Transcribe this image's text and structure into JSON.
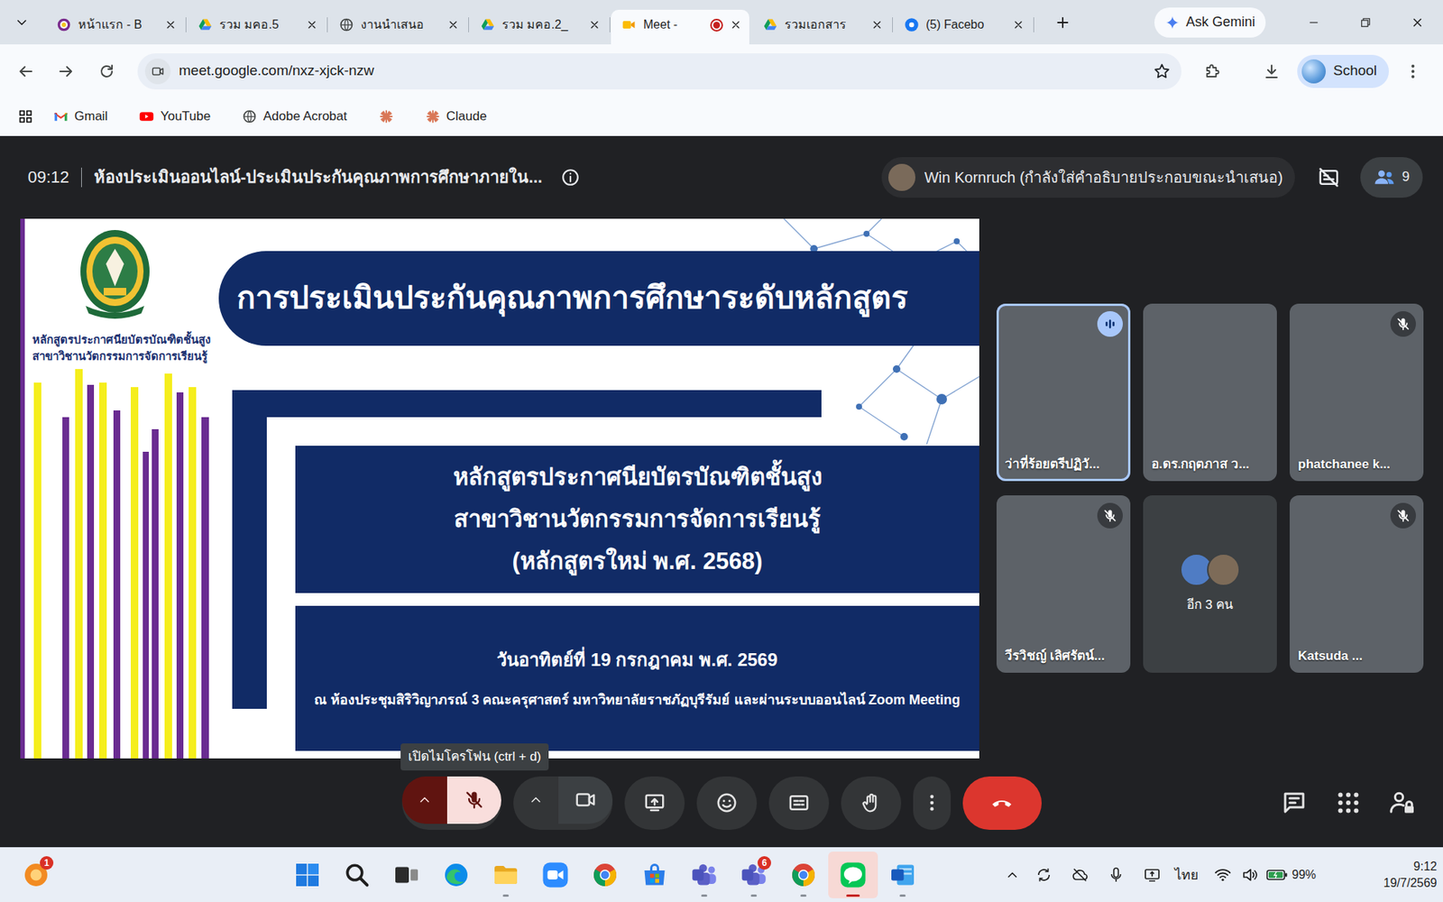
{
  "browser": {
    "tabs": [
      {
        "label": "หน้าแรก - B",
        "kind": "school",
        "selected": false,
        "recording": false
      },
      {
        "label": "รวม มคอ.5",
        "kind": "drive",
        "selected": false,
        "recording": false
      },
      {
        "label": "งานนำเสนอ",
        "kind": "globe",
        "selected": false,
        "recording": false
      },
      {
        "label": "รวม มคอ.2_",
        "kind": "drive",
        "selected": false,
        "recording": false
      },
      {
        "label": "Meet -",
        "kind": "meet",
        "selected": true,
        "recording": true
      },
      {
        "label": "รวมเอกสาร",
        "kind": "drive",
        "selected": false,
        "recording": false
      },
      {
        "label": "(5) Facebo",
        "kind": "facebook",
        "selected": false,
        "recording": false
      }
    ],
    "gemini": "Ask Gemini",
    "address": "meet.google.com/nxz-xjck-nzw",
    "profile": "School",
    "bookmarks": [
      {
        "kind": "gmail",
        "label": "Gmail"
      },
      {
        "kind": "youtube",
        "label": "YouTube"
      },
      {
        "kind": "acrobat",
        "label": "Adobe Acrobat"
      },
      {
        "kind": "claude"
      },
      {
        "kind": "claude",
        "label": "Claude"
      }
    ]
  },
  "meet": {
    "time": "09:12",
    "title": "ห้องประเมินออนไลน์-ประเมินประกันคุณภาพการศึกษาภายใน...",
    "presenter": "Win Kornruch (กำลังใส่คำอธิบายประกอบขณะนำเสนอ)",
    "participant_count": "9",
    "slide": {
      "side_title": [
        "หลักสูตรประกาศนียบัตรบัณฑิตชั้นสูง",
        "สาขาวิชานวัตกรรมการจัดการเรียนรู้"
      ],
      "heading": "การประเมินประกันคุณภาพการศึกษาระดับหลักสูตร",
      "program": [
        "หลักสูตรประกาศนียบัตรบัณฑิตชั้นสูง",
        "สาขาวิชานวัตกรรมการจัดการเรียนรู้",
        "(หลักสูตรใหม่ พ.ศ. 2568)"
      ],
      "date": "วันอาทิตย์ที่ 19 กรกฎาคม พ.ศ. 2569",
      "venue": "ณ ห้องประชุมสิริวิญาภรณ์ 3 คณะครุศาสตร์ มหาวิทยาลัยราชภัฏบุรีรัมย์ และผ่านระบบออนไลน์ Zoom Meeting"
    },
    "tiles": [
      {
        "kind": "video",
        "name": "ว่าที่ร้อยตรีปฏิวั...",
        "muted": false,
        "speaking": true
      },
      {
        "kind": "video",
        "name": "อ.ดร.กฤตภาส ว...",
        "muted": false,
        "speaking": false
      },
      {
        "kind": "video",
        "name": "phatchanee k...",
        "muted": true,
        "speaking": false
      },
      {
        "kind": "video",
        "name": "วีรวิชญ์ เลิศรัตน์...",
        "muted": true,
        "speaking": false
      },
      {
        "kind": "others",
        "name": "อีก 3 คน",
        "muted": false,
        "speaking": false
      },
      {
        "kind": "video",
        "name": "Katsuda ...",
        "muted": true,
        "speaking": false
      }
    ],
    "tooltip": "เปิดไมโครโฟน (ctrl + d)",
    "controls": {
      "mic_muted": true,
      "camera_on": true
    }
  },
  "taskbar": {
    "widget": {
      "badge": "1"
    },
    "apps": [
      {
        "kind": "start",
        "running": false,
        "flashing": false
      },
      {
        "kind": "search",
        "running": false,
        "flashing": false
      },
      {
        "kind": "taskview",
        "running": false,
        "flashing": false
      },
      {
        "kind": "edge",
        "running": false,
        "flashing": false
      },
      {
        "kind": "explorer",
        "running": true,
        "flashing": false
      },
      {
        "kind": "zoom",
        "running": false,
        "flashing": false
      },
      {
        "kind": "chrome",
        "running": false,
        "flashing": false
      },
      {
        "kind": "store",
        "running": false,
        "flashing": false
      },
      {
        "kind": "teams",
        "running": true,
        "flashing": false
      },
      {
        "kind": "teams",
        "badge": "6",
        "running": true,
        "flashing": false
      },
      {
        "kind": "chrome",
        "running": true,
        "flashing": false
      },
      {
        "kind": "line",
        "running": true,
        "flashing": true
      },
      {
        "kind": "word",
        "running": true,
        "flashing": false
      }
    ],
    "tray": {
      "language": "ไทย",
      "battery": "99%",
      "battery_level": 0.99,
      "time": "9:12",
      "date": "19/7/2569"
    }
  }
}
